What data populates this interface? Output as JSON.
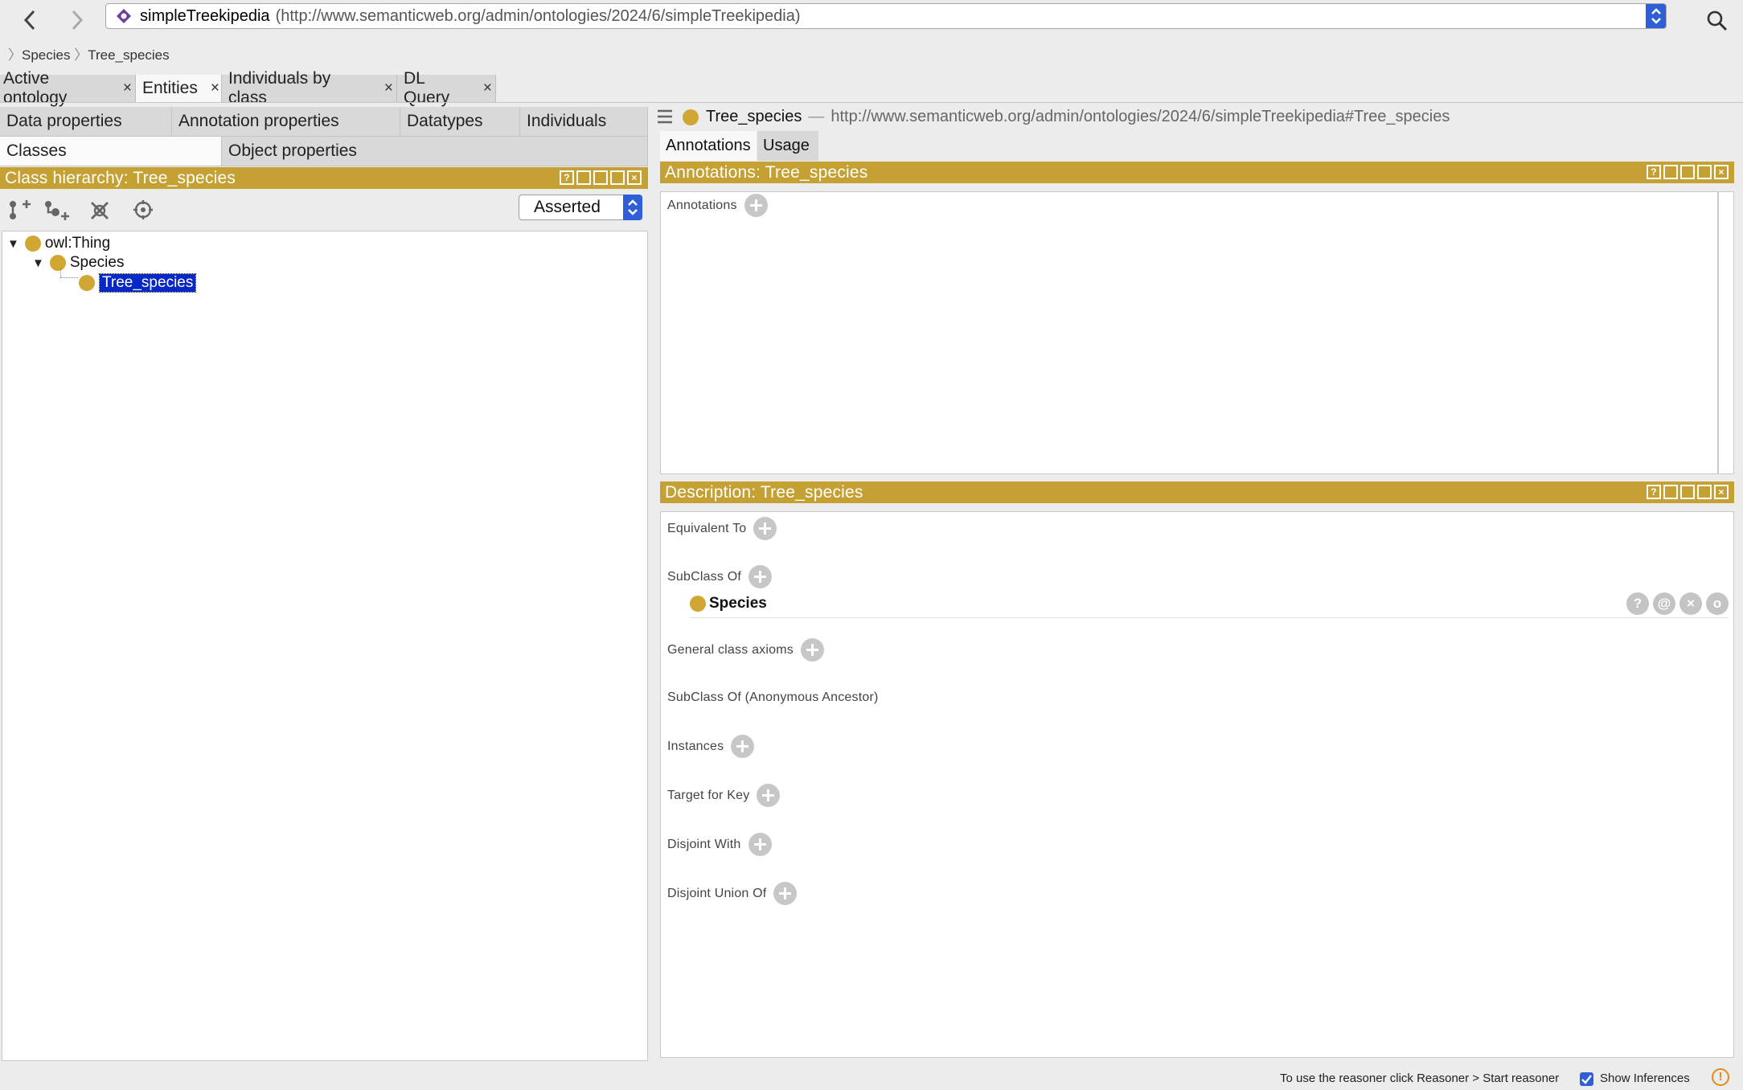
{
  "url_bar": {
    "title": "simpleTreekipedia",
    "url": "(http://www.semanticweb.org/admin/ontologies/2024/6/simpleTreekipedia)"
  },
  "breadcrumb": [
    "Species",
    "Tree_species"
  ],
  "main_tabs": [
    {
      "label": "Active ontology",
      "close": "×"
    },
    {
      "label": "Entities",
      "close": "×"
    },
    {
      "label": "Individuals by class",
      "close": "×"
    },
    {
      "label": "DL Query",
      "close": "×"
    }
  ],
  "entity_tabs": {
    "row1": [
      "Data properties",
      "Annotation properties",
      "Datatypes",
      "Individuals"
    ],
    "row2": [
      "Classes",
      "Object properties"
    ]
  },
  "class_hierarchy": {
    "title": "Class hierarchy: Tree_species",
    "mode": "Asserted",
    "tree": [
      "owl:Thing",
      "Species",
      "Tree_species"
    ]
  },
  "entity_header": {
    "name": "Tree_species",
    "dash": "—",
    "iri": "http://www.semanticweb.org/admin/ontologies/2024/6/simpleTreekipedia#Tree_species"
  },
  "right_tabs": [
    "Annotations",
    "Usage"
  ],
  "annotations_panel": {
    "title": "Annotations: Tree_species",
    "label": "Annotations"
  },
  "description_panel": {
    "title": "Description: Tree_species",
    "sections": {
      "equivalent_to": "Equivalent To",
      "subclass_of": "SubClass Of",
      "subclass_value": "Species",
      "general_axioms": "General class axioms",
      "anon_ancestor": "SubClass Of (Anonymous Ancestor)",
      "instances": "Instances",
      "target_for_key": "Target for Key",
      "disjoint_with": "Disjoint With",
      "disjoint_union": "Disjoint Union Of"
    },
    "row_buttons": [
      "?",
      "@",
      "×",
      "o"
    ]
  },
  "status_bar": {
    "hint": "To use the reasoner click Reasoner > Start reasoner",
    "show_inferences": "Show Inferences",
    "warning": "!"
  },
  "colors": {
    "gold": "#c5a032",
    "class_dot": "#d2a633",
    "selection": "#0828c6",
    "accent": "#2f5fd6"
  }
}
